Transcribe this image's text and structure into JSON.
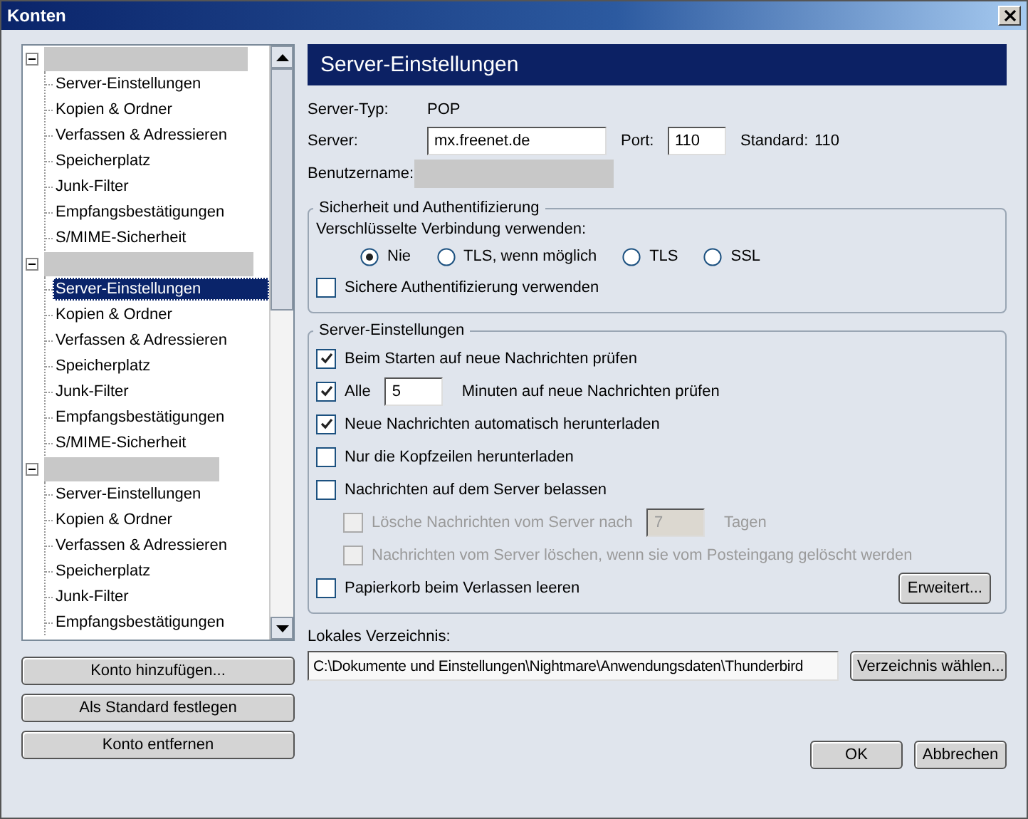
{
  "window": {
    "title": "Konten"
  },
  "accounts": [
    {
      "expanded": true,
      "items": [
        {
          "label": "Server-Einstellungen",
          "selected": false
        },
        {
          "label": "Kopien & Ordner",
          "selected": false
        },
        {
          "label": "Verfassen & Adressieren",
          "selected": false
        },
        {
          "label": "Speicherplatz",
          "selected": false
        },
        {
          "label": "Junk-Filter",
          "selected": false
        },
        {
          "label": "Empfangsbestätigungen",
          "selected": false
        },
        {
          "label": "S/MIME-Sicherheit",
          "selected": false
        }
      ]
    },
    {
      "expanded": true,
      "items": [
        {
          "label": "Server-Einstellungen",
          "selected": true
        },
        {
          "label": "Kopien & Ordner",
          "selected": false
        },
        {
          "label": "Verfassen & Adressieren",
          "selected": false
        },
        {
          "label": "Speicherplatz",
          "selected": false
        },
        {
          "label": "Junk-Filter",
          "selected": false
        },
        {
          "label": "Empfangsbestätigungen",
          "selected": false
        },
        {
          "label": "S/MIME-Sicherheit",
          "selected": false
        }
      ]
    },
    {
      "expanded": true,
      "items": [
        {
          "label": "Server-Einstellungen",
          "selected": false
        },
        {
          "label": "Kopien & Ordner",
          "selected": false
        },
        {
          "label": "Verfassen & Adressieren",
          "selected": false
        },
        {
          "label": "Speicherplatz",
          "selected": false
        },
        {
          "label": "Junk-Filter",
          "selected": false
        },
        {
          "label": "Empfangsbestätigungen",
          "selected": false
        }
      ]
    }
  ],
  "account_buttons": [
    "Konto hinzufügen...",
    "Als Standard festlegen",
    "Konto entfernen"
  ],
  "panel": {
    "heading": "Server-Einstellungen",
    "server_type_label": "Server-Typ:",
    "server_type": "POP",
    "server_label": "Server:",
    "server": "mx.freenet.de",
    "port_label": "Port:",
    "port": "110",
    "default_label": "Standard:",
    "default_port": "110",
    "username_label": "Benutzername:"
  },
  "security": {
    "title": "Sicherheit und Authentifizierung",
    "connection_label": "Verschlüsselte Verbindung verwenden:",
    "options": [
      {
        "label": "Nie",
        "selected": true
      },
      {
        "label": "TLS, wenn möglich",
        "selected": false
      },
      {
        "label": "TLS",
        "selected": false
      },
      {
        "label": "SSL",
        "selected": false
      }
    ],
    "secure_auth": {
      "label": "Sichere Authentifizierung verwenden",
      "checked": false
    }
  },
  "server_settings": {
    "title": "Server-Einstellungen",
    "rows": [
      {
        "kind": "check",
        "label": "Beim Starten auf neue Nachrichten prüfen",
        "checked": true,
        "disabled": false
      },
      {
        "kind": "interval",
        "label": "Alle",
        "value": "5",
        "suffix": "Minuten auf neue Nachrichten prüfen",
        "checked": true,
        "disabled": false
      },
      {
        "kind": "check",
        "label": "Neue Nachrichten automatisch herunterladen",
        "checked": true,
        "disabled": false
      },
      {
        "kind": "check",
        "label": "Nur die Kopfzeilen herunterladen",
        "checked": false,
        "disabled": false
      },
      {
        "kind": "check",
        "label": "Nachrichten auf dem Server belassen",
        "checked": false,
        "disabled": false,
        "children": [
          {
            "kind": "interval",
            "label": "Lösche Nachrichten vom Server nach",
            "value": "7",
            "suffix": "Tagen",
            "checked": false,
            "disabled": true
          },
          {
            "kind": "check",
            "label": "Nachrichten vom Server löschen, wenn sie vom Posteingang gelöscht werden",
            "checked": false,
            "disabled": true
          }
        ]
      },
      {
        "kind": "check",
        "label": "Papierkorb beim Verlassen leeren",
        "checked": false,
        "disabled": false
      }
    ],
    "advanced_button": "Erweitert..."
  },
  "local_dir": {
    "label": "Lokales Verzeichnis:",
    "path": "C:\\Dokumente und Einstellungen\\Nightmare\\Anwendungsdaten\\Thunderbird",
    "button": "Verzeichnis wählen..."
  },
  "dialog_buttons": [
    "OK",
    "Abbrechen"
  ]
}
